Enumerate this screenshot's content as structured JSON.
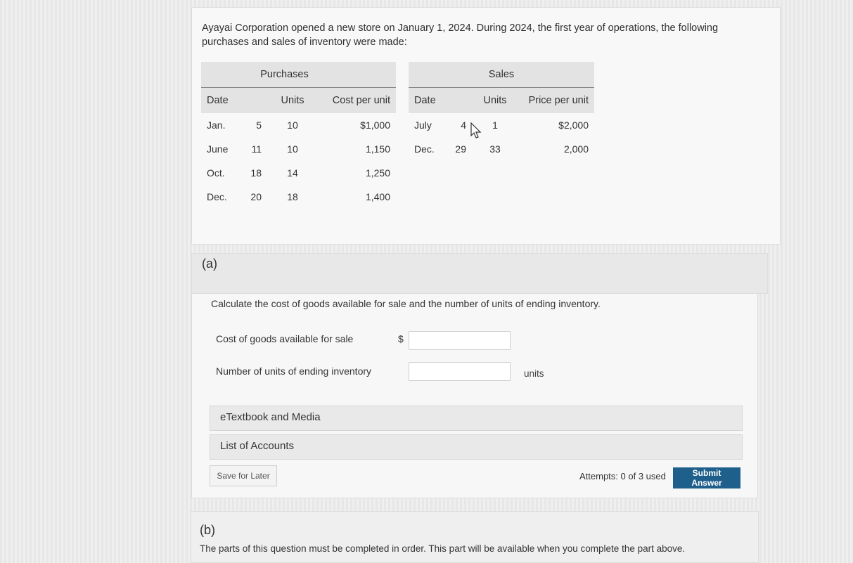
{
  "intro_text": "Ayayai Corporation opened a new store on January 1, 2024. During 2024, the first year of operations, the following purchases and sales of inventory were made:",
  "table": {
    "purchases_title": "Purchases",
    "sales_title": "Sales",
    "purchase_columns": [
      "Date",
      "Units",
      "Cost per unit"
    ],
    "sales_columns": [
      "Date",
      "Units",
      "Price per unit"
    ],
    "purchases": [
      {
        "month": "Jan.",
        "day": "5",
        "units": "10",
        "cost": "$1,000"
      },
      {
        "month": "June",
        "day": "11",
        "units": "10",
        "cost": "1,150"
      },
      {
        "month": "Oct.",
        "day": "18",
        "units": "14",
        "cost": "1,250"
      },
      {
        "month": "Dec.",
        "day": "20",
        "units": "18",
        "cost": "1,400"
      }
    ],
    "sales": [
      {
        "month": "July",
        "day": "4",
        "units": "1",
        "price": "$2,000"
      },
      {
        "month": "Dec.",
        "day": "29",
        "units": "33",
        "price": "2,000"
      }
    ]
  },
  "part_a": {
    "label": "(a)",
    "prompt": "Calculate the cost of goods available for sale and the number of units of ending inventory.",
    "field_cogs_label": "Cost of goods available for sale",
    "currency_symbol": "$",
    "cogs_value": "",
    "field_units_label": "Number of units of ending inventory",
    "units_value": "",
    "units_suffix": "units",
    "etextbook_label": "eTextbook and Media",
    "accounts_label": "List of Accounts",
    "save_label": "Save for Later",
    "attempts_text": "Attempts: 0 of 3 used",
    "submit_label": "Submit Answer"
  },
  "part_b": {
    "label": "(b)",
    "text": "The parts of this question must be completed in order. This part will be available when you complete the part above."
  }
}
